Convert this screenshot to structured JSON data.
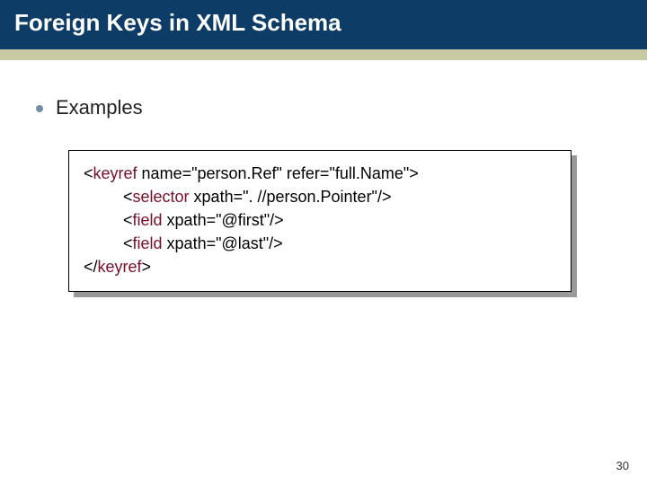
{
  "title": "Foreign Keys in XML Schema",
  "bullet": "Examples",
  "code": {
    "l1": {
      "open": "<",
      "kw": "keyref",
      "rest": " name=\"person.Ref\" refer=\"full.Name\">"
    },
    "l2": {
      "open": "<",
      "kw": "selector",
      "rest": " xpath=\". //person.Pointer\"/>"
    },
    "l3": {
      "open": "<",
      "kw": "field",
      "rest": " xpath=\"@first\"/>"
    },
    "l4": {
      "open": "<",
      "kw": "field",
      "rest": " xpath=\"@last\"/>"
    },
    "l5": {
      "open": "</",
      "kw": "keyref",
      "rest": ">"
    }
  },
  "page_number": "30"
}
